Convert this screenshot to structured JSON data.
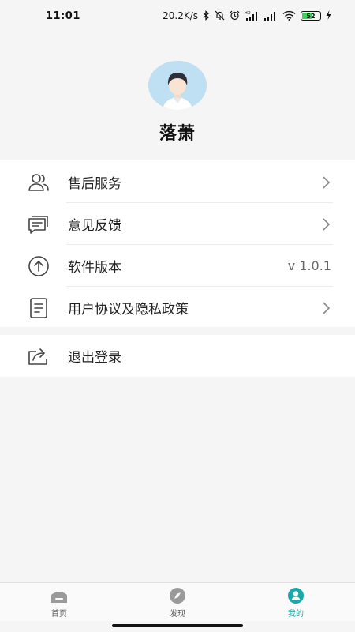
{
  "status_bar": {
    "time": "11:01",
    "net_speed": "20.2K/s",
    "battery": "52",
    "icons": [
      "bluetooth-icon",
      "mute-icon",
      "alarm-icon",
      "hd-signal-icon",
      "signal-icon",
      "wifi-icon",
      "charging-icon"
    ]
  },
  "profile": {
    "nickname": "落萧",
    "avatar_icon": "default-avatar"
  },
  "menu": {
    "items": [
      {
        "label": "售后服务",
        "icon": "users-icon",
        "right": ""
      },
      {
        "label": "意见反馈",
        "icon": "feedback-icon",
        "right": ""
      },
      {
        "label": "软件版本",
        "icon": "upload-icon",
        "right": "v 1.0.1"
      },
      {
        "label": "用户协议及隐私政策",
        "icon": "document-icon",
        "right": ""
      }
    ],
    "logout_label": "退出登录"
  },
  "tabbar": {
    "items": [
      {
        "label": "首页",
        "icon": "home-icon"
      },
      {
        "label": "发现",
        "icon": "compass-icon"
      },
      {
        "label": "我的",
        "icon": "person-icon"
      }
    ],
    "active_index": 2
  },
  "colors": {
    "accent": "#1aa9a8",
    "background": "#f5f5f5",
    "avatar_bg": "#bfe0f2"
  }
}
